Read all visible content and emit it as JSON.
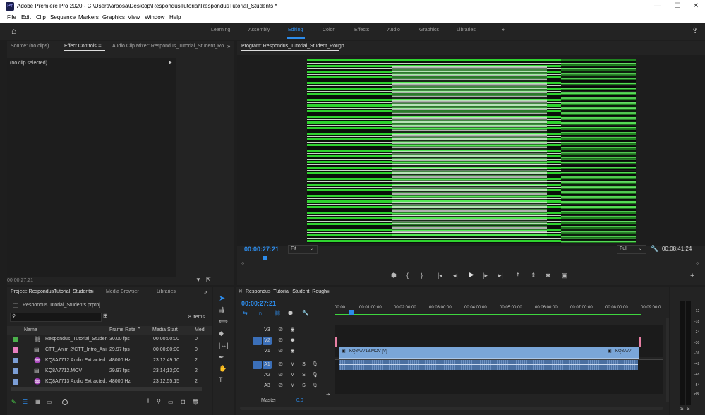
{
  "titlebar": {
    "app_icon": "Pr",
    "title": "Adobe Premiere Pro 2020 - C:\\Users\\aroosa\\Desktop\\RespondusTutorial\\RespondusTutorial_Students *",
    "minimize": "—",
    "maximize": "☐",
    "close": "✕"
  },
  "menu": [
    "File",
    "Edit",
    "Clip",
    "Sequence",
    "Markers",
    "Graphics",
    "View",
    "Window",
    "Help"
  ],
  "workspaces": [
    "Learning",
    "Assembly",
    "Editing",
    "Color",
    "Effects",
    "Audio",
    "Graphics",
    "Libraries"
  ],
  "workspace_more": "»",
  "source_panel": {
    "tabs": [
      "Source: (no clips)",
      "Effect Controls",
      "Audio Clip Mixer: Respondus_Tutorial_Student_Ro"
    ],
    "no_clip": "(no clip selected)",
    "timecode": "00:00:27:21"
  },
  "program_monitor": {
    "title": "Program: Respondus_Tutorial_Student_Rough",
    "timecode": "00:00:27:21",
    "fit": "Fit",
    "quality": "Full",
    "duration": "00:08:41:24"
  },
  "project_panel": {
    "tabs": [
      "Project: RespondusTutorial_Students",
      "Media Browser",
      "Libraries"
    ],
    "file": "RespondusTutorial_Students.prproj",
    "items_count": "8 Items",
    "columns": [
      "Name",
      "Frame Rate",
      "Media Start",
      "Med"
    ],
    "rows": [
      {
        "name": "Respondus_Tutorial_Studen",
        "rate": "30.00 fps",
        "start": "00:00:00:00",
        "extra": "0",
        "color": "#4bb04b"
      },
      {
        "name": "CTT_Anim 2/CTT_Intro_Ani",
        "rate": "29.97 fps",
        "start": "00;00;00;00",
        "extra": "0",
        "color": "#e87fc0"
      },
      {
        "name": "KQ8A7712 Audio Extracted.",
        "rate": "48000 Hz",
        "start": "23:12:49:10",
        "extra": "2",
        "color": "#7b9ed6"
      },
      {
        "name": "KQ8A7712.MOV",
        "rate": "29.97 fps",
        "start": "23;14;13;00",
        "extra": "2",
        "color": "#7b9ed6"
      },
      {
        "name": "KQ8A7713 Audio Extracted.",
        "rate": "48000 Hz",
        "start": "23:12:55:15",
        "extra": "2",
        "color": "#7b9ed6"
      }
    ]
  },
  "timeline": {
    "tab": "Respondus_Tutorial_Student_Rough",
    "timecode": "00:00:27:21",
    "ruler": [
      "00:00",
      "00:01:00:00",
      "00:02:00:00",
      "00:03:00:00",
      "00:04:00:00",
      "00:05:00:00",
      "00:06:00:00",
      "00:07:00:00",
      "00:08:00:00",
      "00:09:00:0"
    ],
    "video_tracks": [
      "V3",
      "V2",
      "V1"
    ],
    "audio_tracks": [
      "A1",
      "A2",
      "A3"
    ],
    "clip_v1": "KQ8A7713.MOV [V]",
    "clip_v1b": "KQ8A77",
    "master": "Master",
    "master_val": "0.0",
    "mute": "M",
    "solo": "S"
  },
  "audio_meter": {
    "scale": [
      "-12",
      "-18",
      "-24",
      "-30",
      "-36",
      "-42",
      "-48",
      "-54",
      "dB"
    ]
  },
  "colors": {
    "accent": "#2d8ceb",
    "video_clip": "#7aa6d8",
    "audio_clip": "#4a6fa0"
  }
}
